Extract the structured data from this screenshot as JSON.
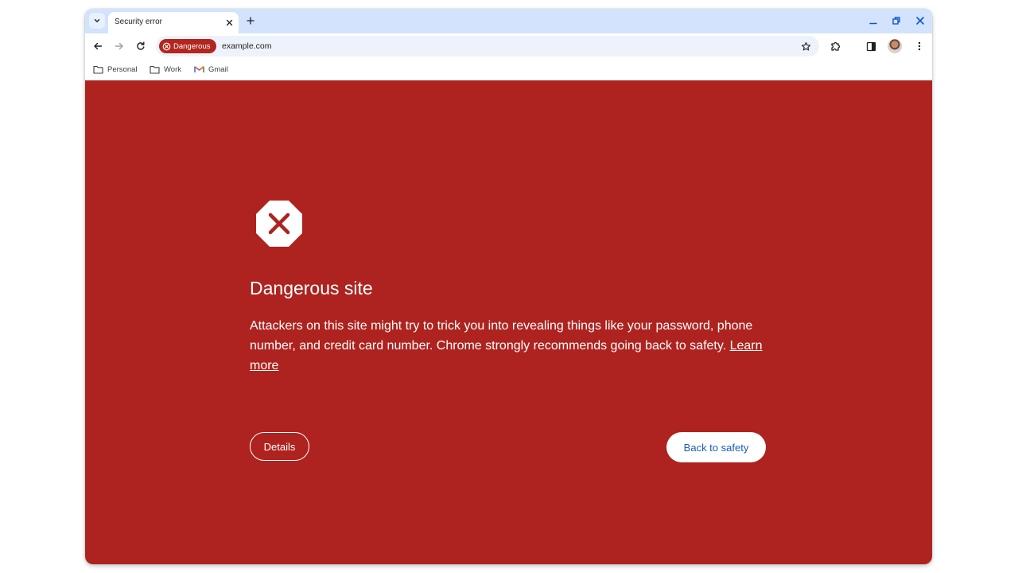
{
  "tab": {
    "title": "Security error"
  },
  "omnibox": {
    "chip_label": "Dangerous",
    "url": "example.com"
  },
  "bookmarks": [
    {
      "label": "Personal",
      "icon": "folder-icon"
    },
    {
      "label": "Work",
      "icon": "folder-icon"
    },
    {
      "label": "Gmail",
      "icon": "gmail-icon"
    }
  ],
  "interstitial": {
    "heading": "Dangerous site",
    "body": "Attackers on this site might try to trick you into revealing things like your password, phone number, and credit card number. Chrome strongly recommends going back to safety. ",
    "learn_more": "Learn more",
    "details_label": "Details",
    "back_label": "Back to safety"
  },
  "colors": {
    "danger_background": "#ae231f",
    "chip_red": "#b3261e",
    "tabstrip": "#d3e3fd",
    "primary_blue": "#1a5eb5"
  }
}
